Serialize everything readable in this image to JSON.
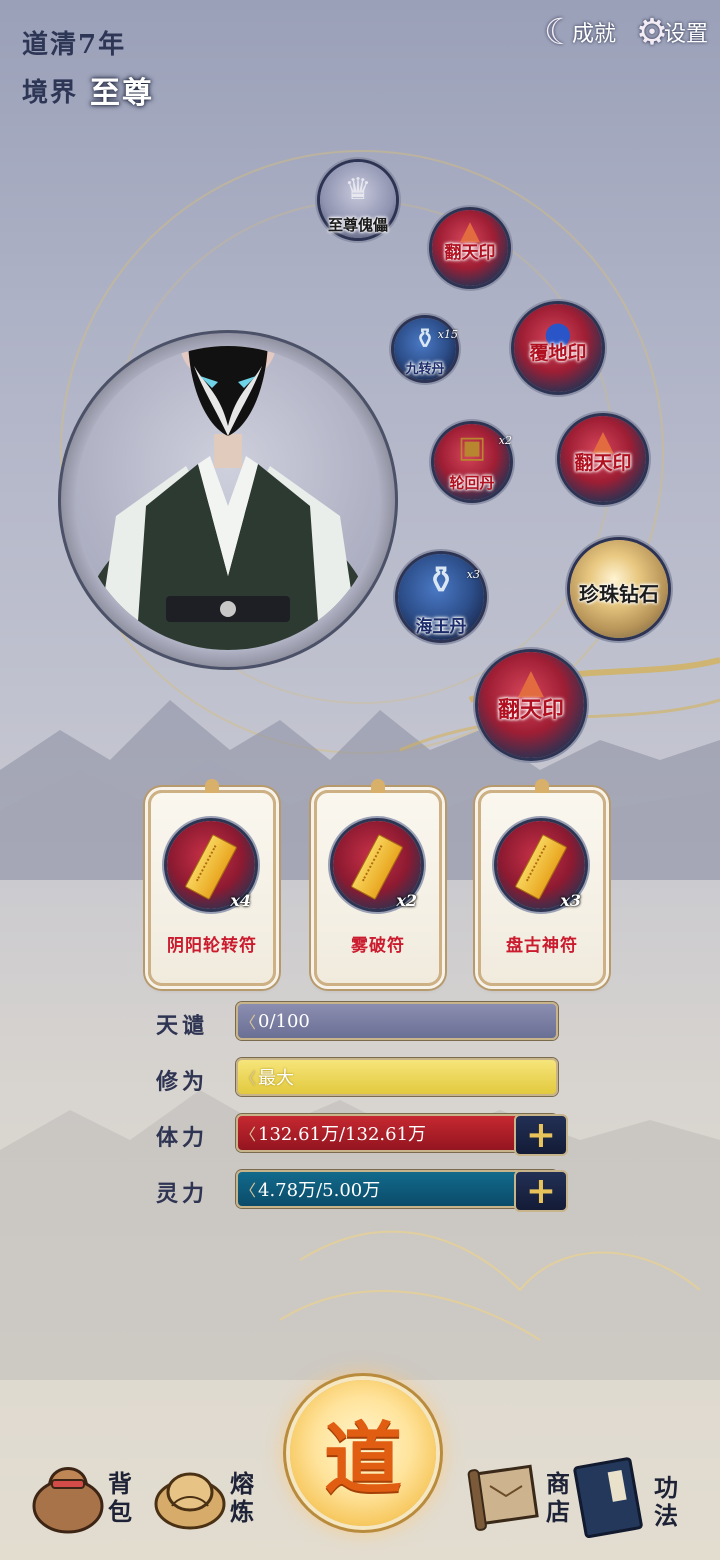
{
  "header": {
    "era": "道清7年",
    "realm_label": "境界",
    "realm_value": "至尊",
    "achievements_label": "成就",
    "settings_label": "设置"
  },
  "items": [
    {
      "name": "至尊傀儡",
      "count": ""
    },
    {
      "name": "翻天印",
      "count": ""
    },
    {
      "name": "九转丹",
      "count": "x15"
    },
    {
      "name": "覆地印",
      "count": ""
    },
    {
      "name": "轮回丹",
      "count": "x2"
    },
    {
      "name": "翻天印",
      "count": ""
    },
    {
      "name": "海王丹",
      "count": "x3"
    },
    {
      "name": "珍珠钻石",
      "count": ""
    },
    {
      "name": "翻天印",
      "count": ""
    }
  ],
  "talismans": [
    {
      "name": "阴阳轮转符",
      "count": "x4"
    },
    {
      "name": "雾破符",
      "count": "x2"
    },
    {
      "name": "盘古神符",
      "count": "x3"
    }
  ],
  "stats": {
    "tianqian": {
      "label": "天谴",
      "value": "0/100"
    },
    "xiuwei": {
      "label": "修为",
      "value": "最大"
    },
    "tili": {
      "label": "体力",
      "value": "132.61万/132.61万"
    },
    "lingli": {
      "label": "灵力",
      "value": "4.78万/5.00万"
    }
  },
  "nav": {
    "bag": "背包",
    "smelt": "熔炼",
    "center": "道",
    "shop": "商店",
    "skills": "功法"
  }
}
